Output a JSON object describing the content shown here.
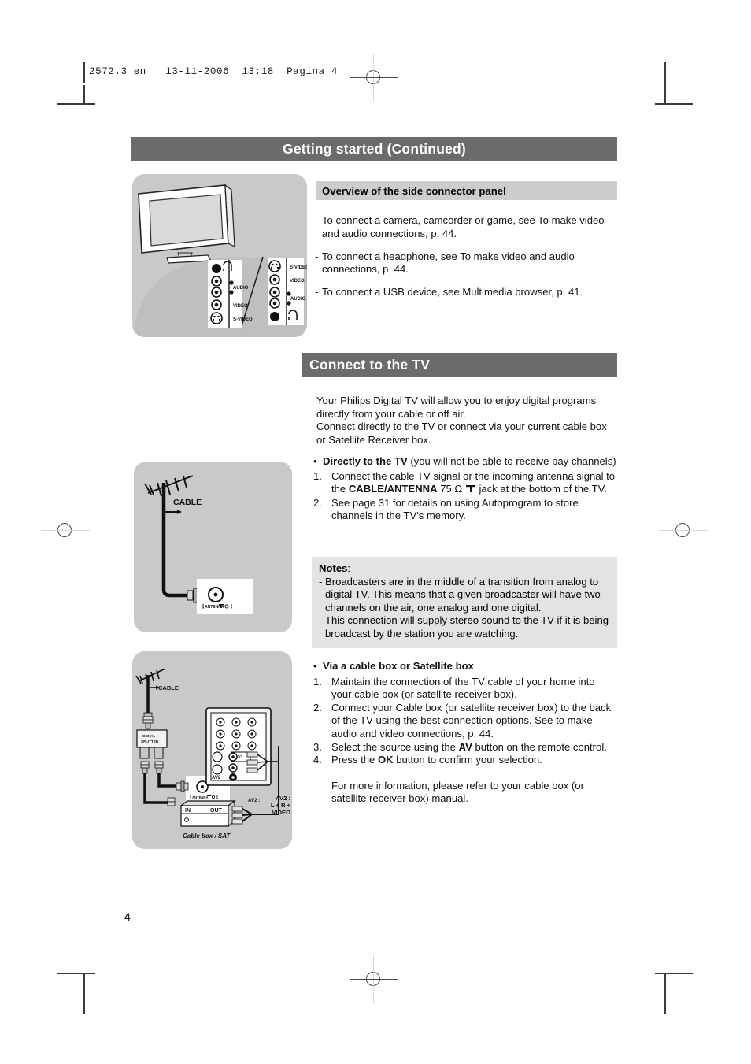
{
  "printer": {
    "file_header": "2572.3 en   13-11-2006  13:18  Pagina 4"
  },
  "page_number": "4",
  "colors": {
    "title_bar": "#6b6b6b",
    "subtitle_bar": "#cdcdcd",
    "notes_bg": "#e3e3e3",
    "illustration_bg": "#c9c9c9"
  },
  "section_getting_started": {
    "title": "Getting started (Continued)",
    "subtitle": "Overview of the side connector panel",
    "bullets": [
      "To connect a camera, camcorder or game, see To make video and audio connections, p. 44.",
      "To connect a headphone, see To make video and audio connections, p. 44.",
      "To connect a USB device, see Multimedia browser, p. 41."
    ],
    "dash": "-"
  },
  "side_panel_diagram": {
    "left_panel_labels": [
      "AUDIO",
      "VIDEO",
      "S-VIDEO"
    ],
    "right_panel_labels": [
      "S-VIDEO",
      "VIDEO",
      "AUDIO"
    ],
    "headphone_icon": "headphone-icon"
  },
  "section_connect_tv": {
    "title": "Connect to the TV",
    "intro": [
      "Your Philips Digital TV will allow you to enjoy digital programs directly from your cable or off air.",
      "Connect directly to the TV or connect via your current cable box or Satellite Receiver box."
    ],
    "direct": {
      "bullet_mark": "•",
      "heading_bold": "Directly to the TV",
      "heading_rest": " (you will not be able to receive pay channels)",
      "steps": [
        {
          "num": "1.",
          "parts": [
            {
              "text": "Connect the cable TV signal or the incoming antenna signal to the ",
              "bold": false
            },
            {
              "text": "CABLE/ANTENNA",
              "bold": true
            },
            {
              "text": " 75 Ω ",
              "bold": false
            },
            {
              "text": "╤",
              "bold": false,
              "icon": "antenna-jack-icon"
            },
            {
              "text": " jack at the bottom of the TV.",
              "bold": false
            }
          ]
        },
        {
          "num": "2.",
          "parts": [
            {
              "text": "See page 31 for details on using Autoprogram to store channels in the TV's memory.",
              "bold": false
            }
          ]
        }
      ]
    },
    "notes": {
      "heading_bold": "Notes",
      "heading_suffix": ":",
      "dash": "-",
      "items": [
        "Broadcasters are in the middle of a transition from analog to digital TV. This means that a given broadcaster will have two channels on the air, one analog and one digital.",
        "This connection will supply stereo sound to the TV if it is being broadcast by the station you are watching."
      ]
    },
    "via_box": {
      "bullet_mark": "•",
      "heading": "Via a cable box or Satellite box",
      "steps": [
        {
          "num": "1.",
          "parts": [
            {
              "text": "Maintain the connection of the TV cable of your home into your cable box (or satellite receiver box).",
              "bold": false
            }
          ]
        },
        {
          "num": "2.",
          "parts": [
            {
              "text": "Connect your Cable box (or satellite receiver box) to the back of the TV using the best connection options. See to make audio and video connections, p. 44.",
              "bold": false
            }
          ]
        },
        {
          "num": "3.",
          "parts": [
            {
              "text": "Select the source using the ",
              "bold": false
            },
            {
              "text": "AV",
              "bold": true
            },
            {
              "text": " button on the remote control.",
              "bold": false
            }
          ]
        },
        {
          "num": "4.",
          "parts": [
            {
              "text": "Press the ",
              "bold": false
            },
            {
              "text": "OK",
              "bold": true
            },
            {
              "text": " button to confirm your selection.",
              "bold": false
            }
          ]
        }
      ],
      "footer": "For more information, please refer to your cable box (or satellite receiver box) manual."
    }
  },
  "antenna_diagram": {
    "cable_label": "CABLE",
    "jack_label": "ANTENNA"
  },
  "cablebox_diagram": {
    "cable_label": "CABLE",
    "splitter_label_line1": "SIGNAL",
    "splitter_label_line2": "SPLITTER",
    "jack_label": "ANTENNA",
    "in_label": "IN",
    "out_label": "OUT",
    "device_label": "Cable box / SAT",
    "av2_label_line1": "AV2 :",
    "av2_label_line2": "L + R + VIDEO",
    "panel_av1_label": "AV1",
    "panel_av2_label": "AV2"
  }
}
